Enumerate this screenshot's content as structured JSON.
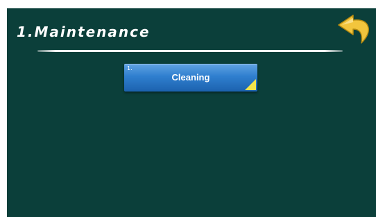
{
  "header": {
    "title": "1.Maintenance",
    "back_icon": "back-arrow-icon",
    "back_icon_color": "#f2c53d"
  },
  "menu": {
    "items": [
      {
        "index": "1.",
        "label": "Cleaning",
        "corner_color": "#f2e34a"
      }
    ]
  },
  "colors": {
    "background": "#0b3f3a",
    "button": "#2f7fcf",
    "text": "#ffffff"
  }
}
